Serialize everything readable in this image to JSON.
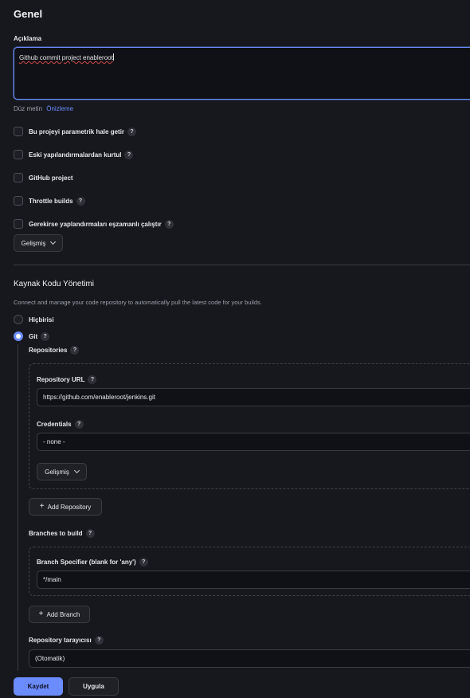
{
  "general": {
    "title": "Genel",
    "description_label": "Açıklama",
    "description_value": "Github commit project enableroot",
    "plain_text": "Düz metin",
    "preview": "Önizleme",
    "options": [
      {
        "label": "Bu projeyi parametrik hale getir",
        "help": true
      },
      {
        "label": "Eski yapılandırmalardan kurtul",
        "help": true
      },
      {
        "label": "GitHub project",
        "help": false
      },
      {
        "label": "Throttle builds",
        "help": true
      },
      {
        "label": "Gerekirse yaplandırmaları eşzamanlı çalıştır",
        "help": true
      }
    ],
    "advanced": "Gelişmiş"
  },
  "scm": {
    "title": "Kaynak Kodu Yönetimi",
    "description": "Connect and manage your code repository to automatically pull the latest code for your builds.",
    "none_label": "Hiçbirisi",
    "git_label": "Git",
    "repositories_label": "Repositories",
    "repo_url_label": "Repository URL",
    "repo_url_value": "https://github.com/enableroot/jenkins.git",
    "credentials_label": "Credentials",
    "credentials_value": "- none -",
    "advanced": "Gelişmiş",
    "add_repository": "Add Repository",
    "branches_label": "Branches to build",
    "branch_specifier_label": "Branch Specifier (blank for 'any')",
    "branch_specifier_value": "*/main",
    "add_branch": "Add Branch",
    "browser_label": "Repository tarayıcısı",
    "browser_value": "(Otomatik)"
  },
  "help_glyph": "?",
  "footer": {
    "save": "Kaydet",
    "apply": "Uygula"
  },
  "colors": {
    "accent": "#6b8cff",
    "background": "#17181d",
    "border": "#3a3c45"
  }
}
